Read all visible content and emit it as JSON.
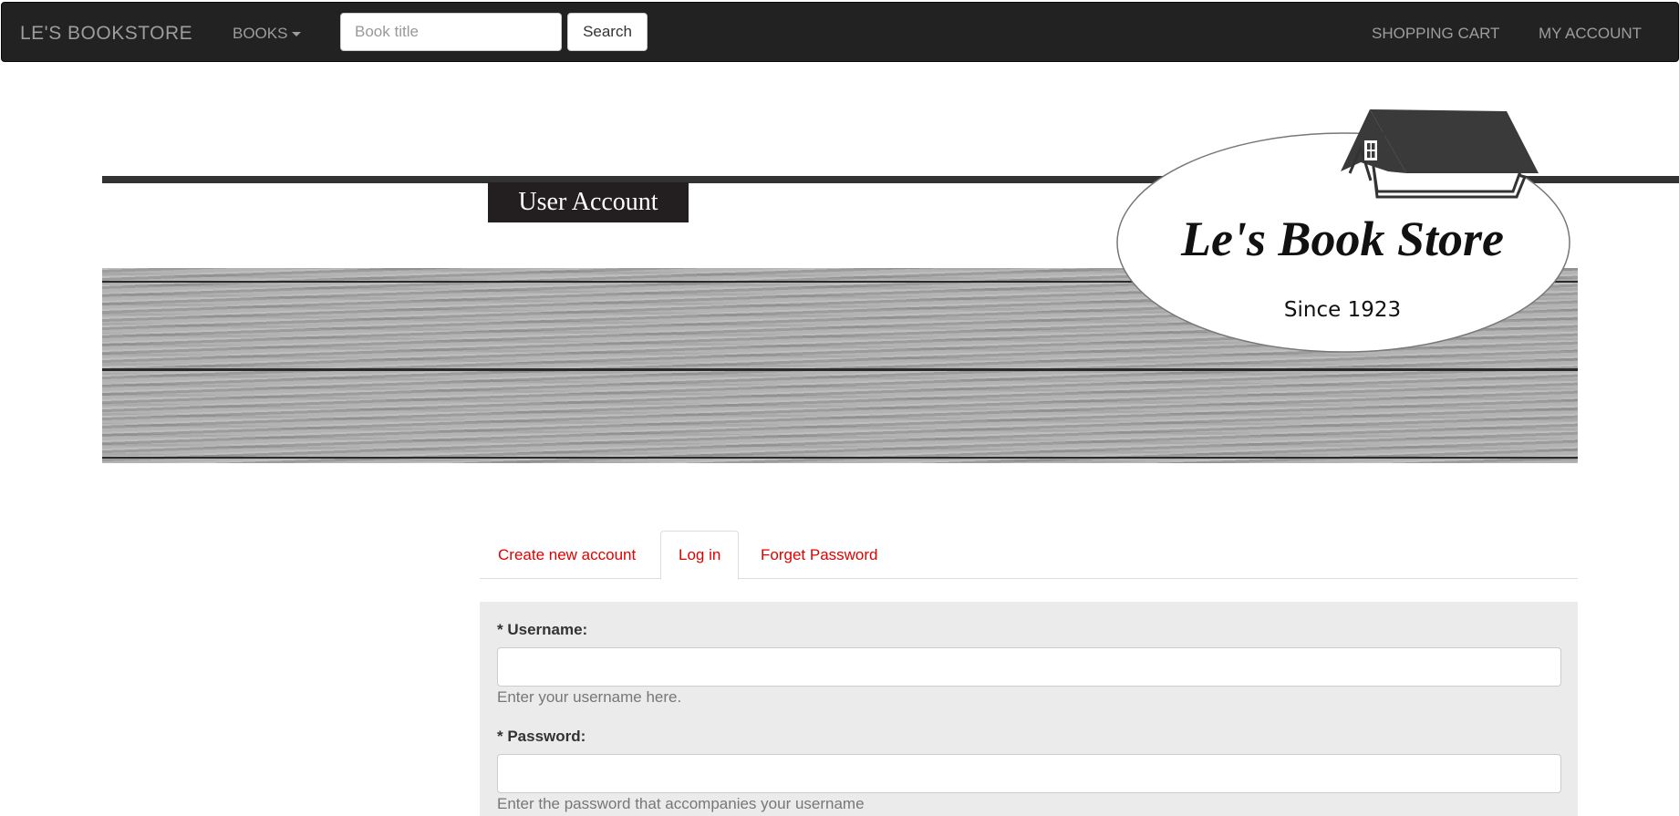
{
  "navbar": {
    "brand": "LE'S BOOKSTORE",
    "books_menu": "BOOKS",
    "search_placeholder": "Book title",
    "search_button": "Search",
    "shopping_cart": "SHOPPING CART",
    "my_account": "MY ACCOUNT"
  },
  "header": {
    "page_title": "User Account",
    "logo": {
      "name": "Le's Book Store",
      "tagline": "Since 1923"
    }
  },
  "tabs": [
    {
      "label": "Create new account",
      "active": false
    },
    {
      "label": "Log in",
      "active": true
    },
    {
      "label": "Forget Password",
      "active": false
    }
  ],
  "form": {
    "username_label": "* Username:",
    "username_value": "",
    "username_help": "Enter your username here.",
    "password_label": "* Password:",
    "password_value": "",
    "password_help": "Enter the password that accompanies your username"
  },
  "colors": {
    "navbar_bg": "#222222",
    "tab_link": "#e00000",
    "form_bg": "#ebebeb"
  }
}
